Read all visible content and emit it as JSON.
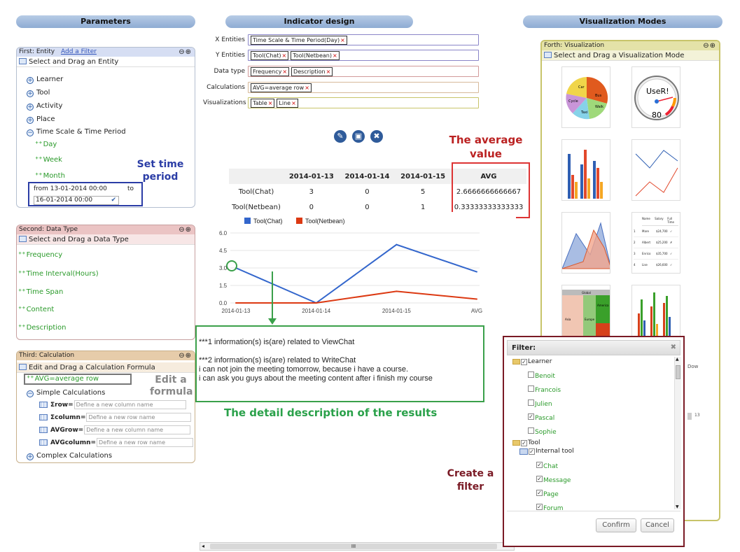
{
  "headers": {
    "parameters": "Parameters",
    "indicator": "Indicator design",
    "modes": "Visualization Modes"
  },
  "entity": {
    "title": "First: Entity",
    "add_filter": "Add a Filter",
    "controls": "⊖⊕",
    "sub": "Select and Drag an Entity",
    "items": [
      "Learner",
      "Tool",
      "Activity",
      "Place"
    ],
    "time_scale": "Time Scale & Time Period",
    "periods": [
      "Day",
      "Week",
      "Month"
    ],
    "from": "from 13-01-2014 00:00",
    "to_label": "to",
    "to": "16-01-2014 00:00"
  },
  "datatype": {
    "title": "Second: Data Type",
    "controls": "⊖⊕",
    "sub": "Select and Drag a Data Type",
    "items": [
      "Frequency",
      "Time Interval(Hours)",
      "Time Span",
      "Content",
      "Description"
    ]
  },
  "calc": {
    "title": "Third: Calculation",
    "controls": "⊖⊕",
    "sub": "Edit and Drag a Calculation Formula",
    "formula": "AVG=average row",
    "simple": "Simple Calculations",
    "rows": [
      {
        "k": "Σrow=",
        "p": "Define a new column name"
      },
      {
        "k": "Σcolumn=",
        "p": "Define a new row name"
      },
      {
        "k": "AVGrow=",
        "p": "Define a new column name"
      },
      {
        "k": "AVGcolumn=",
        "p": "Define a new row name"
      }
    ],
    "complex": "Complex Calculations"
  },
  "design": {
    "x_label": "X Entities",
    "y_label": "Y Entities",
    "dt_label": "Data type",
    "calc_label": "Calculations",
    "vis_label": "Visualizations",
    "x_tags": [
      "Time Scale & Time Period(Day)"
    ],
    "y_tags": [
      "Tool(Chat)",
      "Tool(Netbean)"
    ],
    "dt_tags": [
      "Frequency",
      "Description"
    ],
    "calc_tags": [
      "AVG=average row"
    ],
    "vis_tags": [
      "Table",
      "Line"
    ]
  },
  "table": {
    "headers": [
      "",
      "2014-01-13",
      "2014-01-14",
      "2014-01-15",
      "AVG"
    ],
    "rows": [
      [
        "Tool(Chat)",
        "3",
        "0",
        "5",
        "2.6666666666667"
      ],
      [
        "Tool(Netbean)",
        "0",
        "0",
        "1",
        "0.33333333333333"
      ]
    ]
  },
  "chart_data": {
    "type": "line",
    "categories": [
      "2014-01-13",
      "2014-01-14",
      "2014-01-15",
      "AVG"
    ],
    "series": [
      {
        "name": "Tool(Chat)",
        "values": [
          3,
          0,
          5,
          2.6666666666667
        ],
        "color": "#3366cc"
      },
      {
        "name": "Tool(Netbean)",
        "values": [
          0,
          0,
          1,
          0.33333333333333
        ],
        "color": "#dc3912"
      }
    ],
    "yticks": [
      "6.0",
      "4.5",
      "3.0",
      "1.5",
      "0.0"
    ],
    "ylim": [
      0,
      6
    ],
    "legend": "top",
    "grid": true
  },
  "detail": {
    "lines": [
      "***1 information(s) is(are) related to ViewChat",
      "",
      "***2 information(s) is(are) related to WriteChat",
      "i can not join the meeting tomorrow, because i have a course.",
      "i can ask you guys about the meeting content after i finish my course"
    ]
  },
  "annotations": {
    "set_time": "Set time period",
    "edit_formula": "Edit a formula",
    "avg_value": "The average value",
    "detail_desc": "The detail description of the results",
    "create_filter": "Create a filter"
  },
  "vis": {
    "title": "Forth: Visualization",
    "controls": "⊖⊕",
    "sub": "Select and Drag a Visualization Mode",
    "gauge_label": "UseR!",
    "gauge_value": "80",
    "pie_labels": [
      "Car",
      "Bus",
      "Cycle",
      "Walk",
      "Taxi"
    ],
    "table_headers": [
      "Name",
      "Salary",
      "Full Time"
    ],
    "table_rows": [
      [
        "1",
        "Mare",
        "$24,700",
        "✓"
      ],
      [
        "2",
        "Albert",
        "$25,200",
        "✗"
      ],
      [
        "3",
        "Enrico",
        "$35,700",
        "✓"
      ],
      [
        "4",
        "Lise",
        "$26,600",
        "✓"
      ]
    ],
    "tree_labels": [
      "Global",
      "Asia",
      "Europe",
      "America"
    ]
  },
  "filter": {
    "title": "Filter:",
    "close": "✖",
    "learner": "Learner",
    "learners": [
      "Benoit",
      "Francois",
      "Julien",
      "Pascal",
      "Sophie"
    ],
    "learner_checked": [
      false,
      false,
      false,
      true,
      false
    ],
    "tool": "Tool",
    "internal": "Internal tool",
    "tools": [
      "Chat",
      "Message",
      "Page",
      "Forum"
    ],
    "confirm": "Confirm",
    "cancel": "Cancel",
    "side_text": "Dow",
    "side_text2": "13"
  },
  "scrollbar": {
    "grip": "III"
  }
}
